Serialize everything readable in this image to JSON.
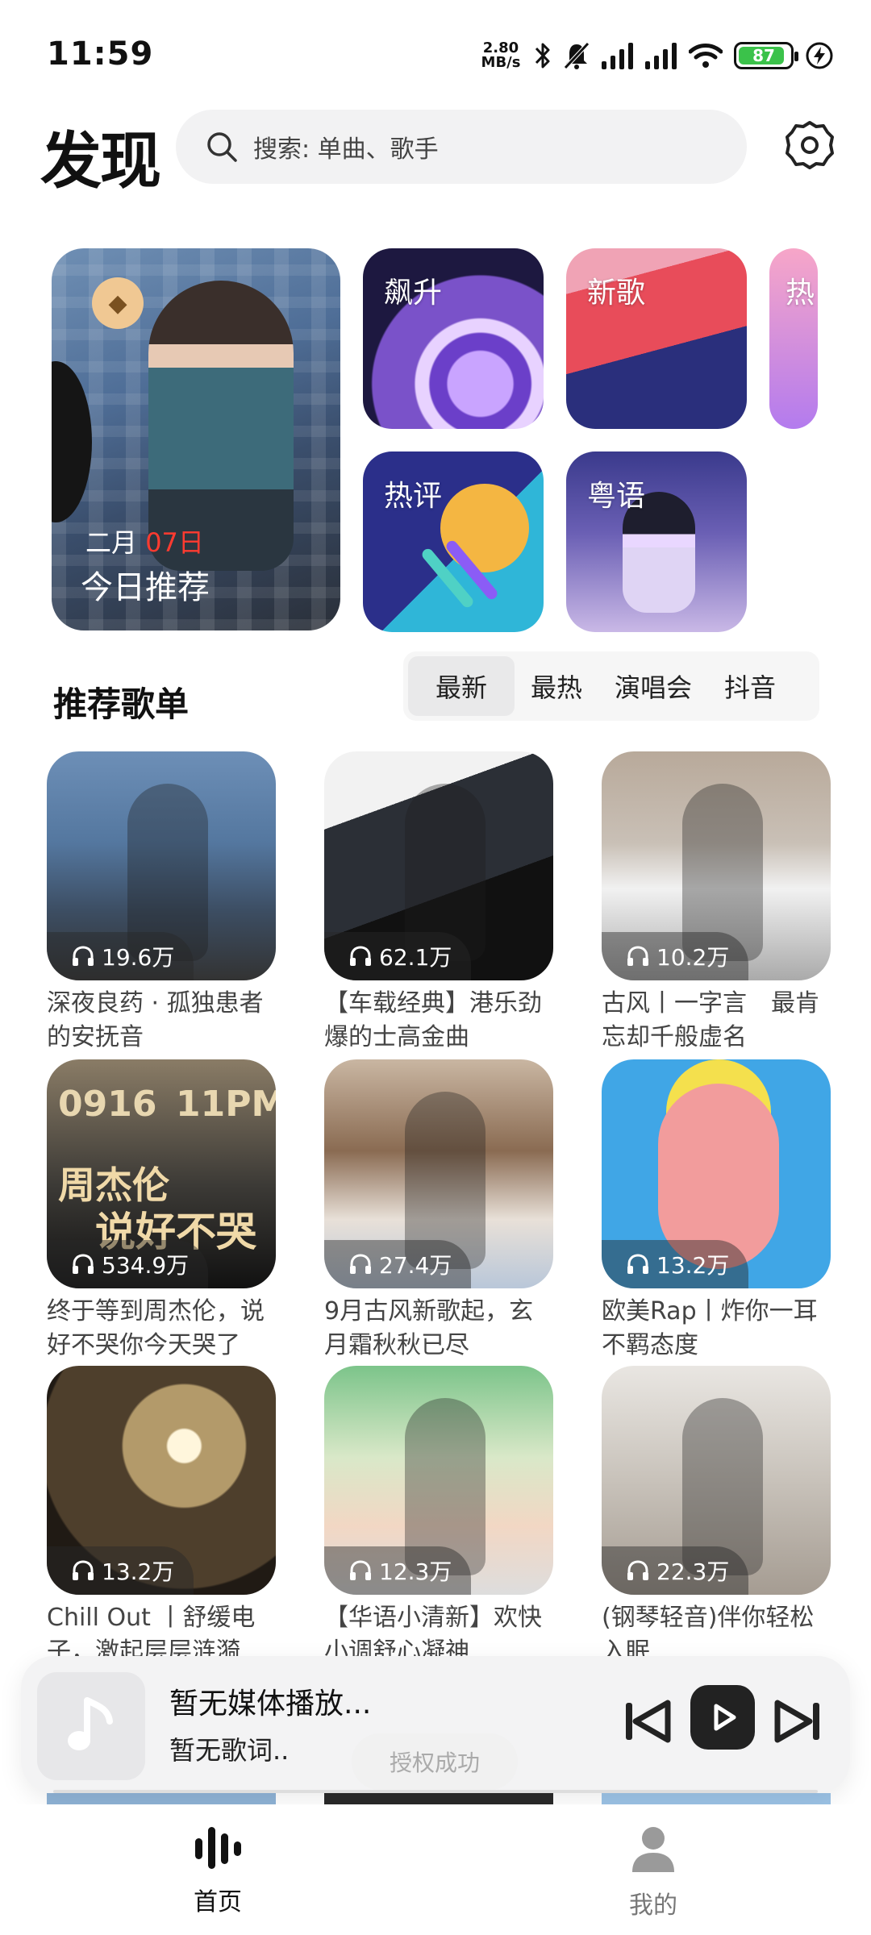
{
  "status_bar": {
    "time": "11:59",
    "net_speed_value": "2.80",
    "net_speed_unit": "MB/s",
    "battery": "87",
    "icons": [
      "bluetooth-icon",
      "mute-icon",
      "signal-icon",
      "signal-icon",
      "wifi-icon",
      "battery-icon",
      "charging-icon"
    ]
  },
  "header": {
    "title": "发现",
    "search_placeholder": "搜索: 单曲、歌手",
    "settings_icon": "gear-icon"
  },
  "featured": {
    "date_month": "二月",
    "date_day": "07日",
    "label": "今日推荐",
    "badge_icon": "diamond-icon",
    "tiles": [
      {
        "label": "飙升"
      },
      {
        "label": "新歌"
      },
      {
        "label": "热"
      },
      {
        "label": "热评"
      },
      {
        "label": "粤语"
      }
    ]
  },
  "playlists_section": {
    "title": "推荐歌单",
    "tabs": [
      "最新",
      "最热",
      "演唱会",
      "抖音"
    ],
    "active_tab": "最新",
    "items": [
      {
        "plays": "19.6万",
        "name": "深夜良药 · 孤独患者的安抚音"
      },
      {
        "plays": "62.1万",
        "name": "【车载经典】港乐劲爆的士高金曲"
      },
      {
        "plays": "10.2万",
        "name": "古风丨一字言　最肯忘却千般虚名"
      },
      {
        "plays": "534.9万",
        "name": "终于等到周杰伦，说好不哭你今天哭了"
      },
      {
        "plays": "27.4万",
        "name": "9月古风新歌起，玄月霜秋秋已尽"
      },
      {
        "plays": "13.2万",
        "name": "欧美Rap丨炸你一耳不羁态度"
      },
      {
        "plays": "13.2万",
        "name": "Chill Out 丨舒缓电子，激起层层涟漪"
      },
      {
        "plays": "12.3万",
        "name": "【华语小清新】欢快小调舒心凝神"
      },
      {
        "plays": "22.3万",
        "name": "(钢琴轻音)伴你轻松入眠"
      }
    ],
    "cover_texts": {
      "jay_1": "0916",
      "jay_2": "11PM",
      "jay_3": "周杰伦",
      "jay_4": "说好不哭"
    }
  },
  "player": {
    "title": "暂无媒体播放...",
    "lyric": "暂无歌词..",
    "progress": 0
  },
  "toast": "授权成功",
  "bottom_nav": {
    "items": [
      {
        "label": "首页",
        "icon": "bars-icon",
        "active": true
      },
      {
        "label": "我的",
        "icon": "person-icon",
        "active": false
      }
    ]
  }
}
